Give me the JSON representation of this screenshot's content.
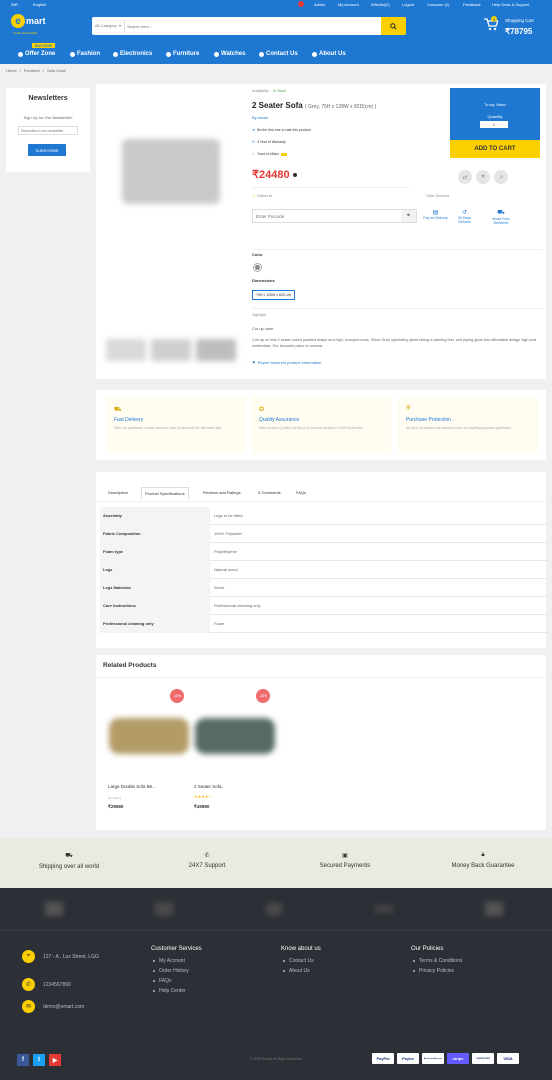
{
  "topbar": {
    "left1": "INR",
    "left2": "English",
    "items": [
      "Admin",
      "My Account",
      "Wishlist(2)",
      "Logout",
      "Compare (2)",
      "Feedback",
      "Help Desk & Support"
    ]
  },
  "header": {
    "logo": "mart",
    "logo_letter": "e",
    "logo_tagline": "Smart Online Mart",
    "category_select": "All Category",
    "search_placeholder": "Search here...",
    "cart_label": "Shopping Cart",
    "cart_total": "₹78795",
    "cart_count": "4"
  },
  "nav": {
    "badge": "BUY NOW",
    "items": [
      "Offer Zone",
      "Fashion",
      "Electronics",
      "Furniture",
      "Watches",
      "Contact Us",
      "About Us"
    ]
  },
  "breadcrumb": [
    "Home",
    "Furniture",
    "Sofa Chair"
  ],
  "newsletter": {
    "title": "Newsletters",
    "text": "Sign Up for Our Newsletter!",
    "placeholder": "Subscribe to our newsletter",
    "button": "SUBSCRIBE"
  },
  "product": {
    "availability_label": "Availability :",
    "availability_value": "In Stock",
    "title": "2 Seater Sofa",
    "title_spec": "( Grey, 75H x 128W x 82D(cm) )",
    "by": "By emart",
    "rate_text": "Be the first one to rate this product",
    "warranty": "3 Year of Warranty",
    "trust": "Trust of eMart",
    "price": "₹24480",
    "deliver_label": "Deliver At",
    "pincode_placeholder": "Enter Pincode",
    "services_label": "Other Services",
    "services": [
      "Pay on Delivery",
      "30 Days Returns",
      "emart Free Delivered"
    ],
    "color_label": "Color",
    "dimension_label": "Dimensions",
    "dimension_value": "75H x 128W x 82D cm",
    "highlight_label": "Highlight",
    "highlight_value": "Cut up calm",
    "description": "Curl up on this 2 seater sofa's padded shape and high, scooped arms. Silver Grey upholstery gives hiking a calming feel, and piping gives this affordable design high-end credentials. Our favourite place to unwind.",
    "report_link": "Report incorrect product information"
  },
  "buybox": {
    "to_buy": "To buy, Select",
    "qty_label": "Quantity",
    "qty_value": "1",
    "add_to_cart": "ADD TO CART"
  },
  "features": [
    {
      "title": "Fast Delivery",
      "text": "With our partnered courier services your product will be delivered fast."
    },
    {
      "title": "Quality Assurance",
      "text": "With emart's Quality checks your product quality is 100% Authentic."
    },
    {
      "title": "Purchase Protection",
      "text": "All your purchases are secured from our leading payment gateways."
    }
  ],
  "tabs": [
    "Description",
    "Product Specifications",
    "Reviews and Ratings",
    "0 Comments",
    "FAQs"
  ],
  "specs": [
    {
      "k": "Assembly",
      "v": "Legs to be fitted"
    },
    {
      "k": "Fabric Composition",
      "v": "100% Polyester"
    },
    {
      "k": "Foam type",
      "v": "Polyethylene"
    },
    {
      "k": "Legs",
      "v": "Natural wood"
    },
    {
      "k": "Legs Materials",
      "v": "Wood"
    },
    {
      "k": "Care Instructions",
      "v": "Professional cleaning only"
    },
    {
      "k": "Professional cleaning only",
      "v": "Foam"
    }
  ],
  "related": {
    "title": "Related Products",
    "items": [
      {
        "name": "Large Double Sofa Be...",
        "rating_text": "No Rating",
        "price": "₹29580",
        "badge": "-15%"
      },
      {
        "name": "2 Seater Sofa,",
        "rating_text": "",
        "price": "₹45980",
        "badge": "-15%"
      }
    ]
  },
  "guarantees": [
    "Shipping over all world",
    "24X7 Support",
    "Secured Payments",
    "Money Back Guarantee"
  ],
  "footer": {
    "address": "127 - A , Lux Street, LGG",
    "phone": "1234567890",
    "email": "demo@emart.com",
    "col1_title": "Customer Services",
    "col1": [
      "My Account",
      "Order History",
      "FAQs",
      "Help Center"
    ],
    "col2_title": "Know about us",
    "col2": [
      "Contact Us",
      "About Us"
    ],
    "col3_title": "Our Policies",
    "col3": [
      "Terms & Conditions",
      "Privacy Policies"
    ],
    "copyright": "© 2020 Emart All Right Reserved",
    "payments": [
      "PayPal",
      "Paytm",
      "AmericanExpress",
      "stripe",
      "mastercard",
      "VISA"
    ]
  },
  "colors": {
    "primary": "#1e78d2",
    "accent": "#fcd000",
    "price": "#e53935",
    "footer": "#2c2f36"
  }
}
